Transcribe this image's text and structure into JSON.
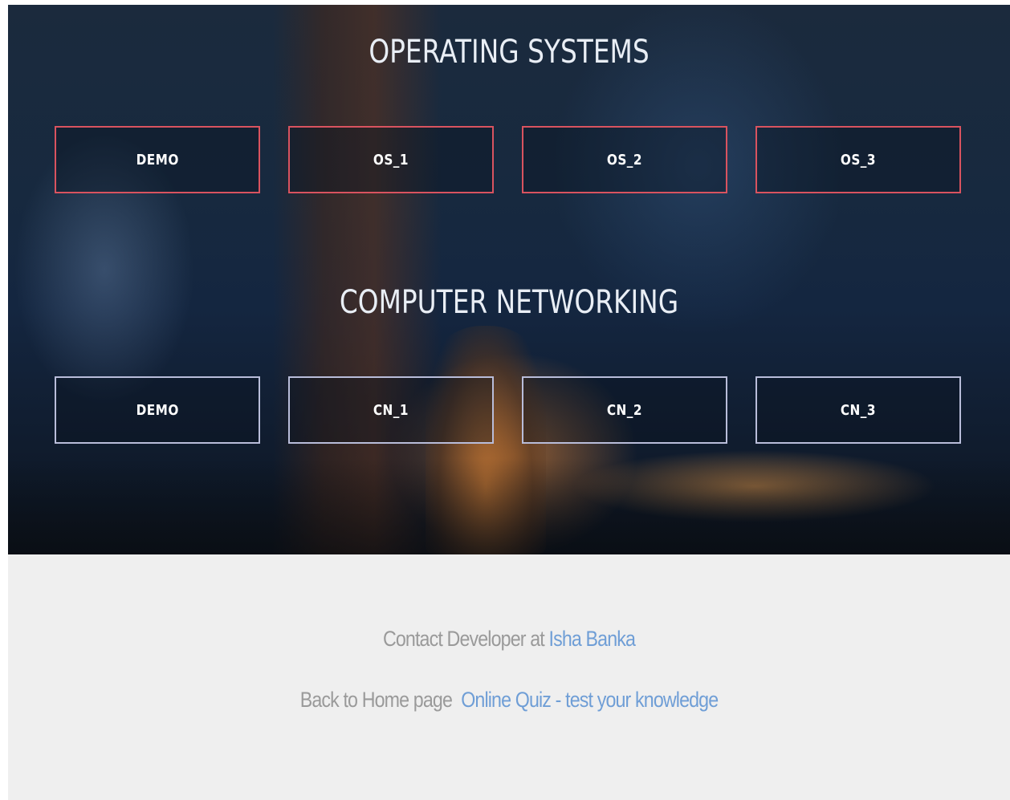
{
  "operating_systems": {
    "title": "OPERATING SYSTEMS",
    "buttons": [
      "DEMO",
      "OS_1",
      "OS_2",
      "OS_3"
    ]
  },
  "computer_networking": {
    "title": "COMPUTER NETWORKING",
    "buttons": [
      "DEMO",
      "CN_1",
      "CN_2",
      "CN_3"
    ]
  },
  "footer": {
    "contact_text": "Contact Developer at",
    "contact_link": "Isha Banka",
    "home_text": "Back to Home page",
    "quiz_link": "Online Quiz - test your knowledge"
  },
  "colors": {
    "os_border": "#d9535f",
    "cn_border": "#b9bdda",
    "link": "#6f9ed6",
    "footer_bg": "#efefef"
  }
}
